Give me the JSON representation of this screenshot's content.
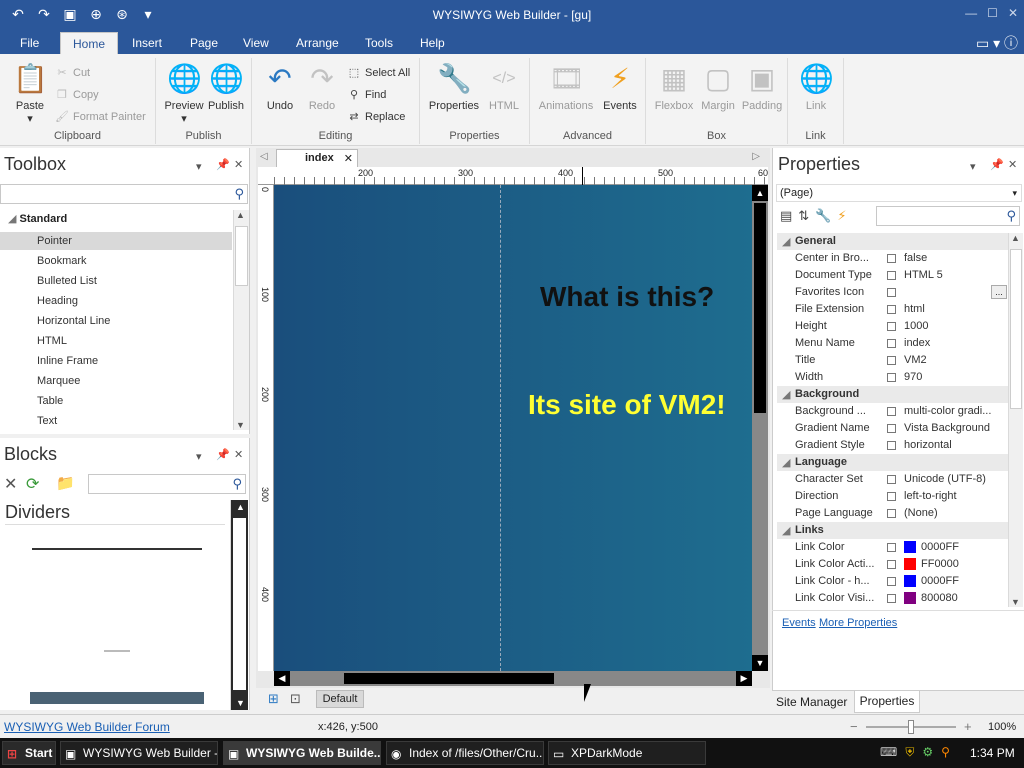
{
  "window": {
    "title": "WYSIWYG Web Builder - [gu]"
  },
  "menu_tabs": [
    "File",
    "Home",
    "Insert",
    "Page",
    "View",
    "Arrange",
    "Tools",
    "Help"
  ],
  "active_tab": "Home",
  "ribbon": {
    "clipboard": {
      "label": "Clipboard",
      "paste": "Paste",
      "cut": "Cut",
      "copy": "Copy",
      "format_painter": "Format Painter"
    },
    "publish": {
      "label": "Publish",
      "preview": "Preview",
      "publish": "Publish"
    },
    "editing": {
      "label": "Editing",
      "undo": "Undo",
      "redo": "Redo",
      "select_all": "Select All",
      "find": "Find",
      "replace": "Replace"
    },
    "properties": {
      "label": "Properties",
      "properties": "Properties",
      "html": "HTML"
    },
    "advanced": {
      "label": "Advanced",
      "animations": "Animations",
      "events": "Events"
    },
    "box": {
      "label": "Box",
      "flexbox": "Flexbox",
      "margin": "Margin",
      "padding": "Padding"
    },
    "link": {
      "label": "Link",
      "link": "Link"
    }
  },
  "toolbox": {
    "title": "Toolbox",
    "category": "Standard",
    "items": [
      "Pointer",
      "Bookmark",
      "Bulleted List",
      "Heading",
      "Horizontal Line",
      "HTML",
      "Inline Frame",
      "Marquee",
      "Table",
      "Text"
    ]
  },
  "blocks": {
    "title": "Blocks",
    "section": "Dividers"
  },
  "document": {
    "tab": "index",
    "ruler_ticks": [
      "200",
      "300",
      "400",
      "500",
      "60"
    ],
    "vruler_ticks": [
      "0",
      "100",
      "200",
      "300",
      "400"
    ],
    "heading1": "What is this?",
    "heading2": "Its site of VM2!",
    "bottom_tab": "Default"
  },
  "properties_panel": {
    "title": "Properties",
    "object": "(Page)",
    "categories": {
      "general": "General",
      "background": "Background",
      "language": "Language",
      "links": "Links"
    },
    "general": [
      {
        "k": "Center in Bro...",
        "v": "false"
      },
      {
        "k": "Document Type",
        "v": "HTML 5"
      },
      {
        "k": "Favorites Icon",
        "v": ""
      },
      {
        "k": "File Extension",
        "v": "html"
      },
      {
        "k": "Height",
        "v": "1000"
      },
      {
        "k": "Menu Name",
        "v": "index"
      },
      {
        "k": "Title",
        "v": "VM2"
      },
      {
        "k": "Width",
        "v": "970"
      }
    ],
    "background": [
      {
        "k": "Background ...",
        "v": "multi-color gradi..."
      },
      {
        "k": "Gradient Name",
        "v": "Vista Background"
      },
      {
        "k": "Gradient Style",
        "v": "horizontal"
      }
    ],
    "language": [
      {
        "k": "Character Set",
        "v": "Unicode (UTF-8)"
      },
      {
        "k": "Direction",
        "v": "left-to-right"
      },
      {
        "k": "Page Language",
        "v": "(None)"
      }
    ],
    "links": [
      {
        "k": "Link Color",
        "v": "0000FF",
        "color": "#0000FF"
      },
      {
        "k": "Link Color Acti...",
        "v": "FF0000",
        "color": "#FF0000"
      },
      {
        "k": "Link Color - h...",
        "v": "0000FF",
        "color": "#0000FF"
      },
      {
        "k": "Link Color Visi...",
        "v": "800080",
        "color": "#800080"
      }
    ],
    "footer_events": "Events",
    "footer_more": "More Properties",
    "tabs": [
      "Site Manager",
      "Properties"
    ]
  },
  "statusbar": {
    "forum": "WYSIWYG Web Builder Forum",
    "coords": "x:426, y:500",
    "zoom": "100%"
  },
  "taskbar": {
    "start": "Start",
    "tasks": [
      "WYSIWYG Web Builder - ...",
      "WYSIWYG Web Builde...",
      "Index of /files/Other/Cru...",
      "XPDarkMode"
    ],
    "clock": "1:34 PM"
  }
}
